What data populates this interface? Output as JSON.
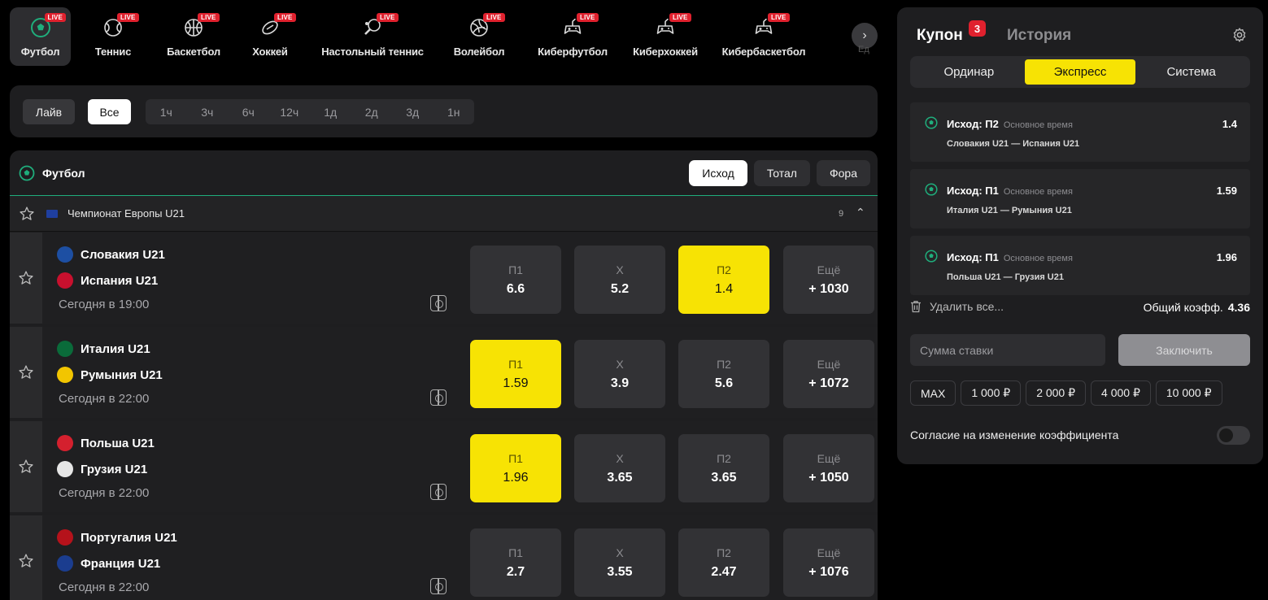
{
  "sports": [
    {
      "label": "Футбол",
      "live": "LIVE",
      "icon": "football-icon",
      "active": true
    },
    {
      "label": "Теннис",
      "live": "LIVE",
      "icon": "tennis-icon"
    },
    {
      "label": "Баскетбол",
      "live": "LIVE",
      "icon": "basketball-icon"
    },
    {
      "label": "Хоккей",
      "live": "LIVE",
      "icon": "hockey-icon"
    },
    {
      "label": "Настольный теннис",
      "live": "LIVE",
      "icon": "table-tennis-icon"
    },
    {
      "label": "Волейбол",
      "live": "LIVE",
      "icon": "volleyball-icon"
    },
    {
      "label": "Киберфутбол",
      "live": "LIVE",
      "icon": "gamepad-icon"
    },
    {
      "label": "Киберхоккей",
      "live": "LIVE",
      "icon": "gamepad-icon"
    },
    {
      "label": "Кибербаскетбол",
      "live": "LIVE",
      "icon": "gamepad-icon"
    }
  ],
  "sports_next": "›",
  "sports_overflow_label": "Ед",
  "filters": {
    "live": "Лайв",
    "all": "Все",
    "times": [
      "1ч",
      "3ч",
      "6ч",
      "12ч",
      "1д",
      "2д",
      "3д",
      "1н"
    ]
  },
  "events": {
    "sport_title": "Футбол",
    "market_tabs": [
      "Исход",
      "Тотал",
      "Фора"
    ],
    "league": {
      "name": "Чемпионат Европы U21",
      "count": "9",
      "chevron": "⌃"
    },
    "matches": [
      {
        "team1": "Словакия U21",
        "team2": "Испания U21",
        "time": "Сегодня в 19:00",
        "crest1": "#1d4fa3",
        "crest2": "#c8102e",
        "odds": [
          {
            "label": "П1",
            "value": "6.6"
          },
          {
            "label": "Х",
            "value": "5.2"
          },
          {
            "label": "П2",
            "value": "1.4",
            "selected": true
          },
          {
            "label": "Ещё",
            "value": "+ 1030"
          }
        ]
      },
      {
        "team1": "Италия U21",
        "team2": "Румыния U21",
        "time": "Сегодня в 22:00",
        "crest1": "#0a6b3a",
        "crest2": "#f2c500",
        "odds": [
          {
            "label": "П1",
            "value": "1.59",
            "selected": true
          },
          {
            "label": "Х",
            "value": "3.9"
          },
          {
            "label": "П2",
            "value": "5.6"
          },
          {
            "label": "Ещё",
            "value": "+ 1072"
          }
        ]
      },
      {
        "team1": "Польша U21",
        "team2": "Грузия U21",
        "time": "Сегодня в 22:00",
        "crest1": "#d4202e",
        "crest2": "#e6e6e6",
        "odds": [
          {
            "label": "П1",
            "value": "1.96",
            "selected": true
          },
          {
            "label": "Х",
            "value": "3.65"
          },
          {
            "label": "П2",
            "value": "3.65"
          },
          {
            "label": "Ещё",
            "value": "+ 1050"
          }
        ]
      },
      {
        "team1": "Португалия U21",
        "team2": "Франция U21",
        "time": "Сегодня в 22:00",
        "crest1": "#b5121b",
        "crest2": "#1b3d8f",
        "odds": [
          {
            "label": "П1",
            "value": "2.7"
          },
          {
            "label": "Х",
            "value": "3.55"
          },
          {
            "label": "П2",
            "value": "2.47"
          },
          {
            "label": "Ещё",
            "value": "+ 1076"
          }
        ]
      }
    ]
  },
  "coupon": {
    "title": "Купон",
    "badge": "3",
    "history": "История",
    "types": [
      "Ординар",
      "Экспресс",
      "Система"
    ],
    "active_type": "Экспресс",
    "bets": [
      {
        "selection": "Исход: П2",
        "period": "Основное время",
        "odd": "1.4",
        "teams": "Словакия U21 — Испания U21"
      },
      {
        "selection": "Исход: П1",
        "period": "Основное время",
        "odd": "1.59",
        "teams": "Италия U21 — Румыния U21"
      },
      {
        "selection": "Исход: П1",
        "period": "Основное время",
        "odd": "1.96",
        "teams": "Польша U21 — Грузия U21"
      }
    ],
    "delete_all": "Удалить все...",
    "total_label": "Общий коэфф.",
    "total_value": "4.36",
    "stake_placeholder": "Сумма ставки",
    "submit": "Заключить",
    "quick_amounts": [
      "MAX",
      "1 000 ₽",
      "2 000 ₽",
      "4 000 ₽",
      "10 000 ₽"
    ],
    "consent": "Согласие на изменение коэффициента"
  },
  "colors": {
    "accent": "#f7e304",
    "live": "#e0212e",
    "green": "#1fae7c"
  }
}
